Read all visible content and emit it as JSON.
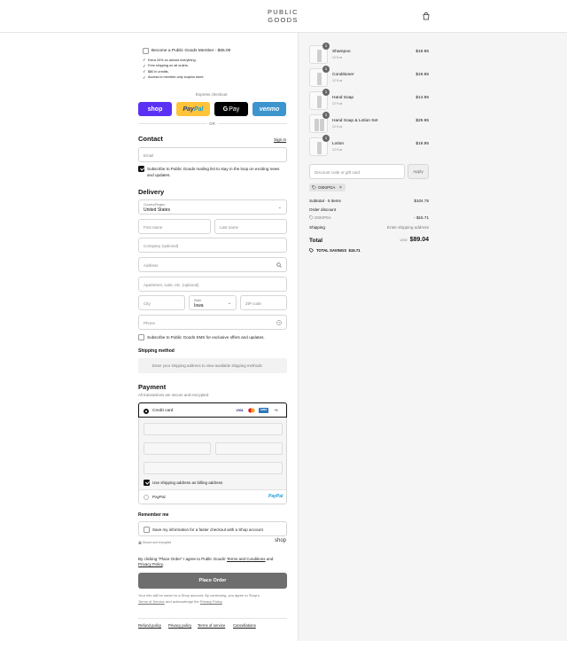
{
  "header": {
    "logo_line1": "PUBLIC",
    "logo_line2": "GOODS",
    "cart_icon": "shopping-bag-icon"
  },
  "membership": {
    "label": "Become a Public Goods Member - $65.00",
    "perks": [
      "Extra 20% on almost everything.",
      "Free shipping on all orders.",
      "$80 in credits.",
      "Access to member-only surplus store."
    ]
  },
  "express": {
    "title": "Express checkout",
    "shop": "shop",
    "paypal_pay": "Pay",
    "paypal_pal": "Pal",
    "gpay_g": "G",
    "gpay_pay": "Pay",
    "venmo": "venmo",
    "or": "OR"
  },
  "contact": {
    "heading": "Contact",
    "signin": "Sign in",
    "email_placeholder": "Email",
    "newsletter_line1": "Subscribe to Public Goods mailing list to stay in the loop on exciting news",
    "newsletter_line2": "and updates."
  },
  "delivery": {
    "heading": "Delivery",
    "country_label": "Country/Region",
    "country_value": "United States",
    "first_name": "First name",
    "last_name": "Last name",
    "company": "Company (optional)",
    "address": "Address",
    "apartment": "Apartment, suite, etc. (optional)",
    "city": "City",
    "state_label": "State",
    "state_value": "Iowa",
    "zip": "ZIP code",
    "phone": "Phone",
    "sms": "Subscribe to Public Goods SMS for exclusive offers and updates."
  },
  "shipping": {
    "heading": "Shipping method",
    "message": "Enter your shipping address to view available shipping methods"
  },
  "payment": {
    "heading": "Payment",
    "subtitle": "All transactions are secure and encrypted.",
    "credit_card": "Credit card",
    "card_visa": "VISA",
    "card_amex": "AMEX",
    "more": "+5",
    "billing_same": "Use shipping address as billing address",
    "paypal": "PayPal",
    "paypal_logo": "PayPal"
  },
  "remember": {
    "heading": "Remember me",
    "save_info": "Save my information for a faster checkout with a Shop account",
    "secure": "Secure and encrypted",
    "shop": "shop"
  },
  "legal": {
    "agree_prefix": "By clicking \"Place Order\" I agree to Public Goods'",
    "terms": "Terms and Conditions",
    "and": "and",
    "privacy": "Privacy Policy",
    "period": ".",
    "place_order": "Place Order",
    "shop_note_line1": "Your info will be saved to a Shop account. By continuing, you agree to Shop's",
    "shop_terms": "Terms of Service",
    "shop_ack": "and acknowledge the",
    "shop_privacy": "Privacy Policy"
  },
  "footer": {
    "links": [
      "Refund policy",
      "Privacy policy",
      "Terms of service",
      "Cancellations"
    ]
  },
  "cart": {
    "items": [
      {
        "qty": "1",
        "name": "Shampoo",
        "size": "12 fl oz",
        "price": "$19.95"
      },
      {
        "qty": "1",
        "name": "Conditioner",
        "size": "12 fl oz",
        "price": "$19.95"
      },
      {
        "qty": "1",
        "name": "Hand Soap",
        "size": "12 fl oz",
        "price": "$14.95"
      },
      {
        "qty": "1",
        "name": "Hand Soap & Lotion Set",
        "size": "12 fl oz",
        "price": "$29.95"
      },
      {
        "qty": "1",
        "name": "Lotion",
        "size": "12 fl oz",
        "price": "$19.95"
      }
    ],
    "discount_placeholder": "Discount code or gift card",
    "apply": "Apply",
    "tag_code": "OSKIPGA",
    "tag_remove": "×",
    "subtotal_label": "Subtotal · 5 items",
    "subtotal_value": "$104.75",
    "order_discount_label": "Order discount",
    "discount_code": "OSKIPGA",
    "discount_value": "- $15.71",
    "shipping_label": "Shipping",
    "shipping_value": "Enter shipping address",
    "total_label": "Total",
    "currency": "USD",
    "total_value": "$89.04",
    "savings_label": "TOTAL SAVINGS",
    "savings_value": "$15.71"
  },
  "colors": {
    "shop": "#5a31f4",
    "paypal": "#ffc439",
    "gpay": "#000000",
    "venmo": "#3d95ce",
    "button_grey": "#6e6e6e"
  }
}
